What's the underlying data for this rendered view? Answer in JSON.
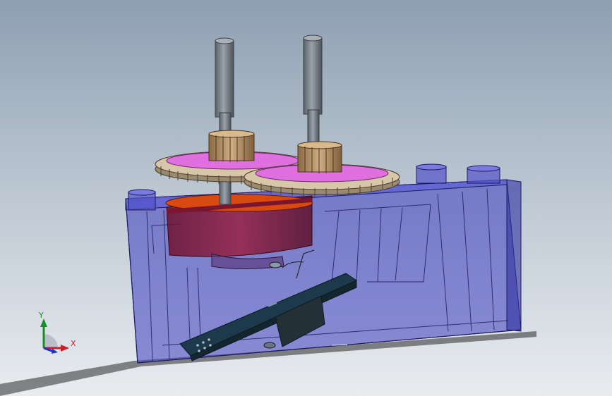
{
  "viewport": {
    "background_top": "#8e9fb2",
    "background_bottom": "#e9ecef"
  },
  "model": {
    "housing_color": "#3a3ab8",
    "gear_color": "#c9b79a",
    "gear_face_color": "#e070e0",
    "pinion_color": "#b78e5e",
    "motor_color": "#8a1a3a",
    "motor_band_color": "#d94a10",
    "shaft_color": "#7f8690",
    "board_color": "#1d3a4c"
  },
  "triad": {
    "y_label": "Y",
    "x_label": "X",
    "y_color": "#1c8a2a",
    "x_color": "#c8202a",
    "z_color": "#2030c0"
  }
}
